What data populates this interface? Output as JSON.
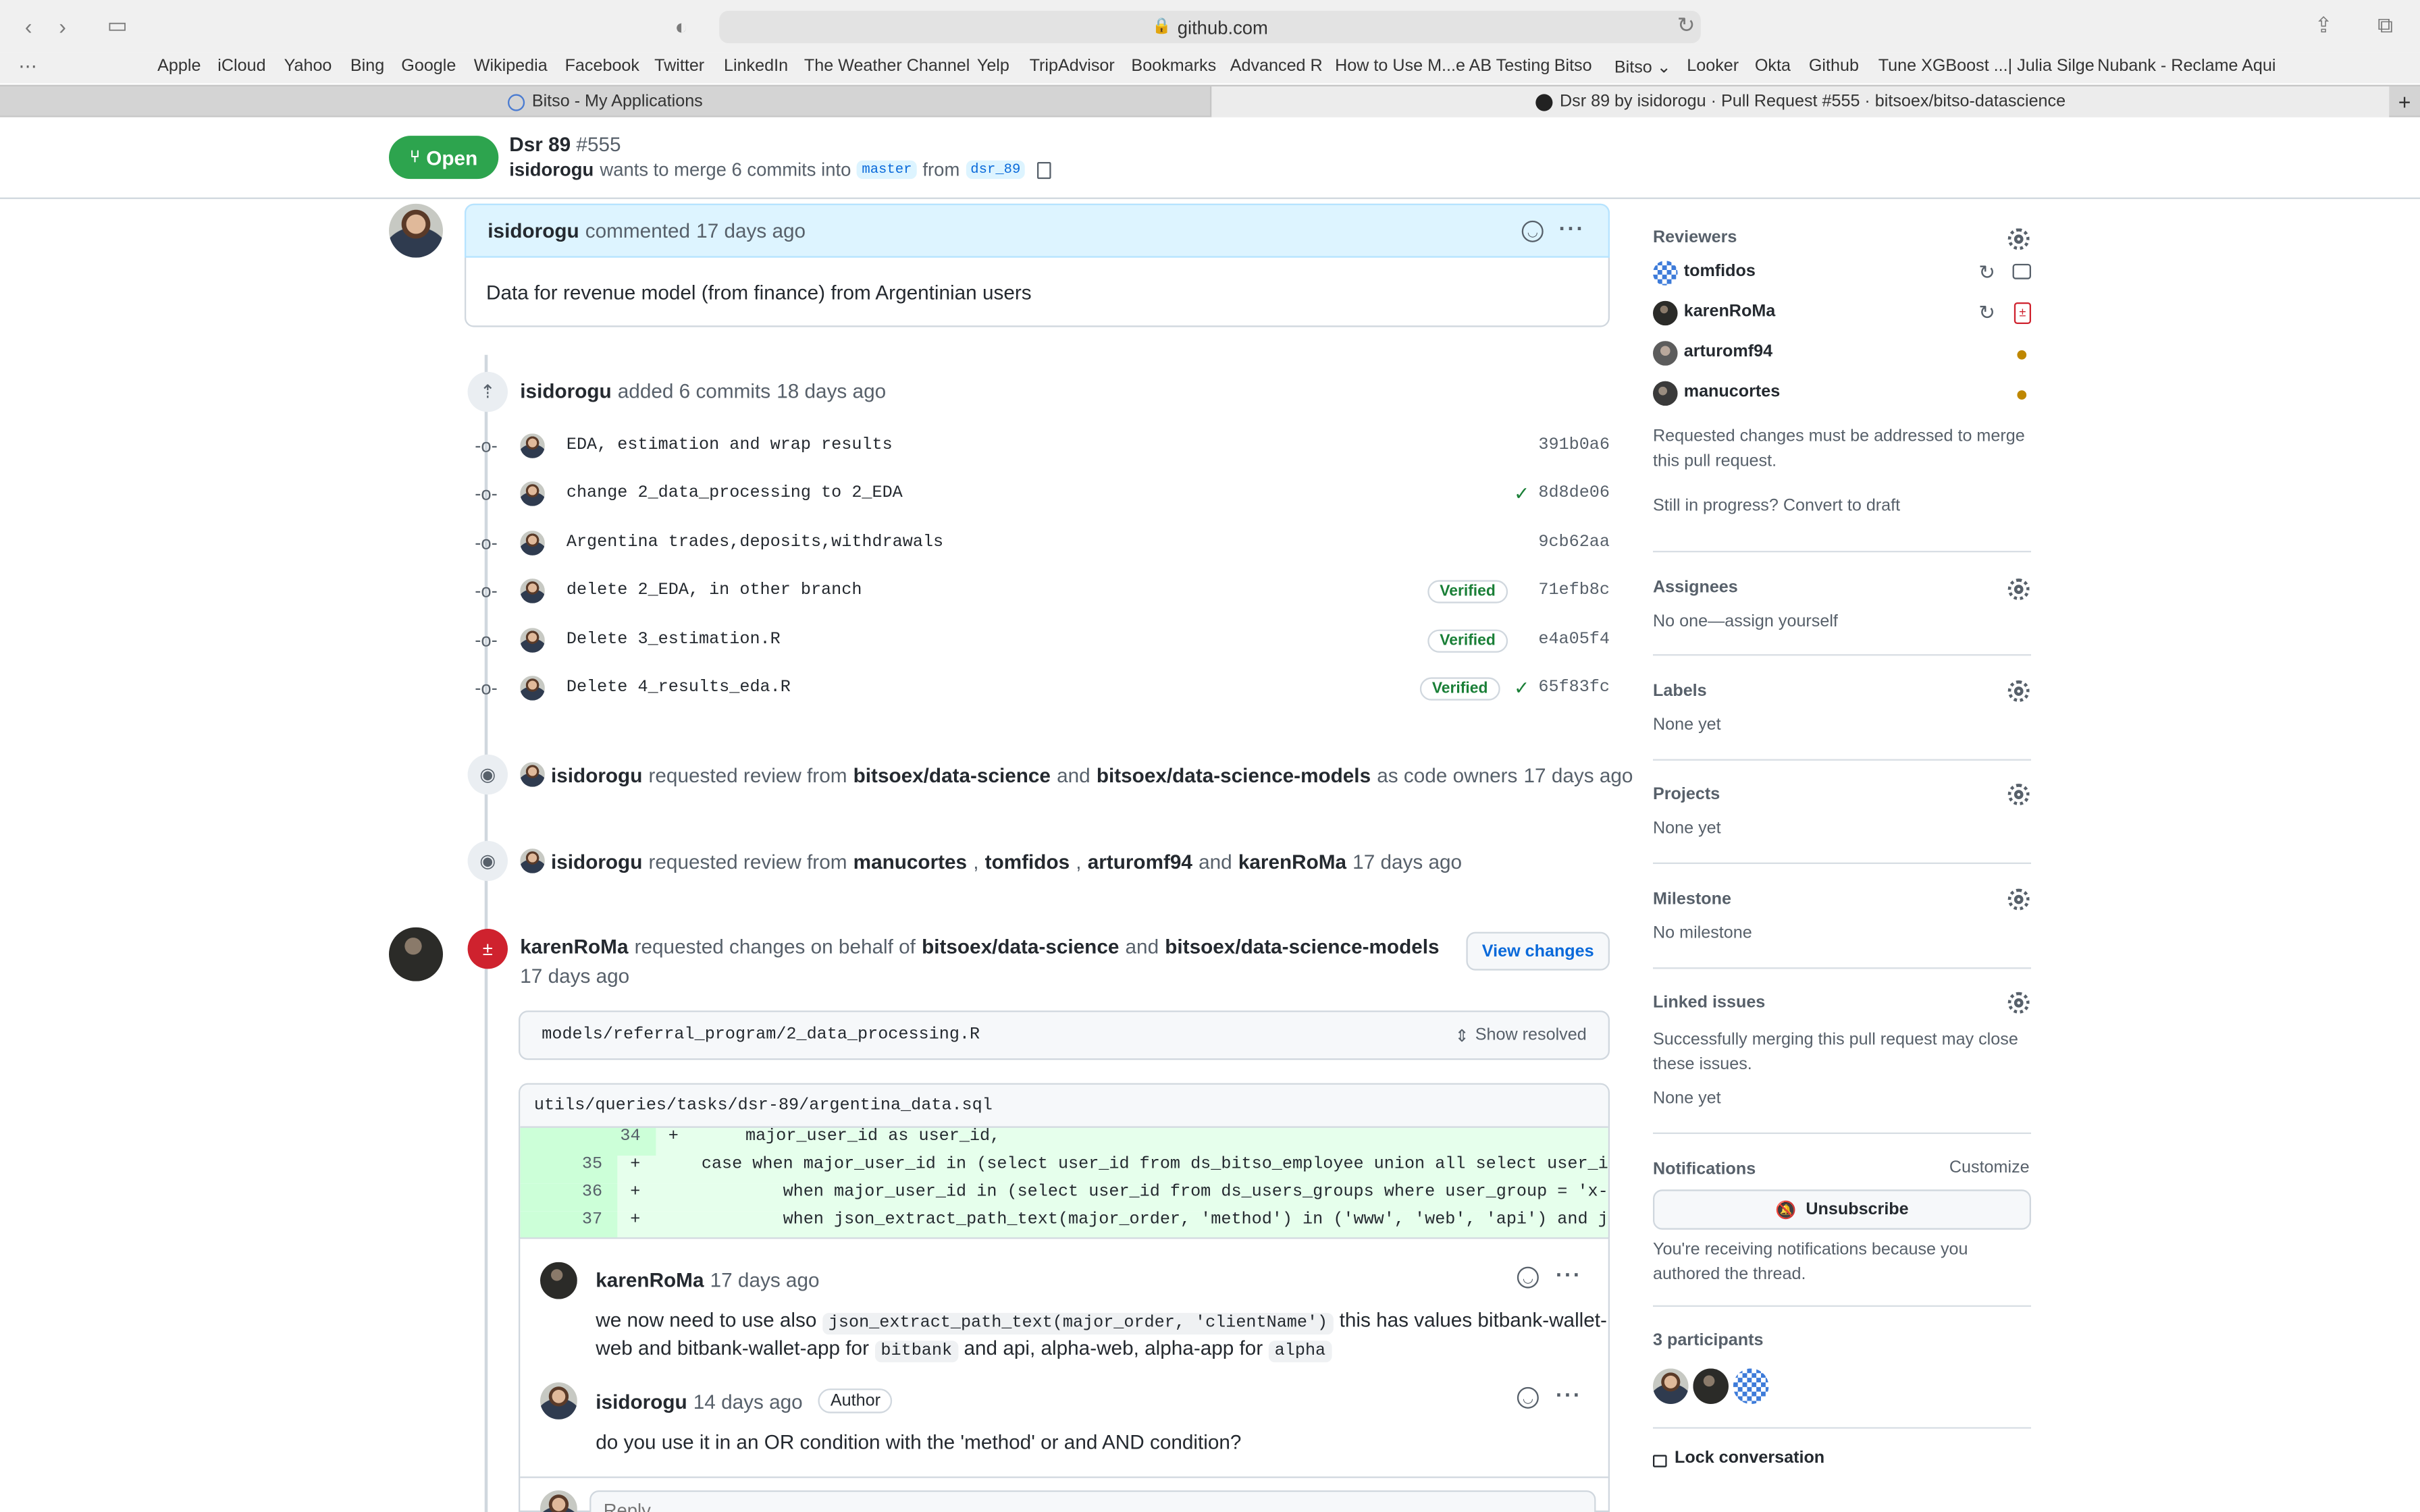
{
  "browser": {
    "url": "github.com",
    "favorites": [
      "Apple",
      "iCloud",
      "Yahoo",
      "Bing",
      "Google",
      "Wikipedia",
      "Facebook",
      "Twitter",
      "LinkedIn",
      "The Weather Channel",
      "Yelp",
      "TripAdvisor",
      "Bookmarks",
      "Advanced R",
      "How to Use M...e AB Testing",
      "Bitso",
      "Bitso",
      "Looker",
      "Okta",
      "Github",
      "Tune XGBoost ...| Julia Silge",
      "Nubank - Reclame Aqui"
    ],
    "tabs": [
      "Bitso - My Applications",
      "Dsr 89 by isidorogu · Pull Request #555 · bitsoex/bitso-datascience"
    ]
  },
  "pr": {
    "state": "Open",
    "title": "Dsr 89",
    "number": "#555",
    "author": "isidorogu",
    "merge_text": "wants to merge 6 commits into",
    "base": "master",
    "from": "from",
    "head": "dsr_89"
  },
  "comment": {
    "author": "isidorogu",
    "action": "commented",
    "time": "17 days ago",
    "body": "Data for revenue model (from finance) from Argentinian users"
  },
  "commits_event": {
    "author": "isidorogu",
    "action": "added 6 commits",
    "time": "18 days ago",
    "items": [
      {
        "msg": "EDA, estimation and wrap results",
        "sha": "391b0a6",
        "verified": "",
        "check": ""
      },
      {
        "msg": "change 2_data_processing to 2_EDA",
        "sha": "8d8de06",
        "verified": "",
        "check": "✓"
      },
      {
        "msg": "Argentina trades,deposits,withdrawals",
        "sha": "9cb62aa",
        "verified": "",
        "check": ""
      },
      {
        "msg": "delete 2_EDA, in other branch",
        "sha": "71efb8c",
        "verified": "Verified",
        "check": ""
      },
      {
        "msg": "Delete 3_estimation.R",
        "sha": "e4a05f4",
        "verified": "Verified",
        "check": ""
      },
      {
        "msg": "Delete 4_results_eda.R",
        "sha": "65f83fc",
        "verified": "Verified",
        "check": "✓"
      }
    ]
  },
  "review_req_1": {
    "author": "isidorogu",
    "text1": "requested review from",
    "team1": "bitsoex/data-science",
    "and": "and",
    "team2": "bitsoex/data-science-models",
    "text2": "as code owners",
    "time": "17 days ago"
  },
  "review_req_2": {
    "author": "isidorogu",
    "text1": "requested review from",
    "u1": "manucortes",
    "u2": "tomfidos",
    "u3": "arturomf94",
    "and": "and",
    "u4": "karenRoMa",
    "time": "17 days ago"
  },
  "changes": {
    "author": "karenRoMa",
    "text1": "requested changes on behalf of",
    "team1": "bitsoex/data-science",
    "and": "and",
    "team2": "bitsoex/data-science-models",
    "time": "17 days ago",
    "view_button": "View changes",
    "file": "models/referral_program/2_data_processing.R",
    "show_resolved": "Show resolved",
    "diff_file": "utils/queries/tasks/dsr-89/argentina_data.sql",
    "diff_lines": [
      {
        "n": "34",
        "code": "major_user_id as user_id,"
      },
      {
        "n": "35",
        "code": "case when major_user_id in (select user_id from ds_bitso_employee union all select user_i"
      },
      {
        "n": "36",
        "code": "        when major_user_id in (select user_id from ds_users_groups where user_group = 'x-"
      },
      {
        "n": "37",
        "code": "        when json_extract_path_text(major_order, 'method') in ('www', 'web', 'api') and j"
      }
    ]
  },
  "thread": {
    "c1_author": "karenRoMa",
    "c1_time": "17 days ago",
    "c1_pre": "we now need to use also",
    "c1_code": "json_extract_path_text(major_order, 'clientName')",
    "c1_post": "this has values bitbank-wallet-",
    "c1_line2_pre": "web and bitbank-wallet-app for",
    "c1_code2": "bitbank",
    "c1_line2_mid": "and api, alpha-web, alpha-app for",
    "c1_code3": "alpha",
    "c2_author": "isidorogu",
    "c2_time": "14 days ago",
    "c2_badge": "Author",
    "c2_body": "do you use it in an OR condition with the 'method' or and AND condition?",
    "reply_placeholder": "Reply..."
  },
  "sidebar": {
    "reviewers_title": "Reviewers",
    "reviewers": [
      "tomfidos",
      "karenRoMa",
      "arturomf94",
      "manucortes"
    ],
    "reviewers_note": "Requested changes must be addressed to merge this pull request.",
    "draft_text": "Still in progress? Convert to draft",
    "assignees_title": "Assignees",
    "assignees_text": "No one—assign yourself",
    "labels_title": "Labels",
    "labels_text": "None yet",
    "projects_title": "Projects",
    "projects_text": "None yet",
    "milestone_title": "Milestone",
    "milestone_text": "No milestone",
    "linked_title": "Linked issues",
    "linked_note": "Successfully merging this pull request may close these issues.",
    "linked_text": "None yet",
    "notifications_title": "Notifications",
    "customize": "Customize",
    "unsubscribe": "Unsubscribe",
    "notif_note": "You're receiving notifications because you authored the thread.",
    "participants": "3 participants",
    "lock": "Lock conversation"
  }
}
